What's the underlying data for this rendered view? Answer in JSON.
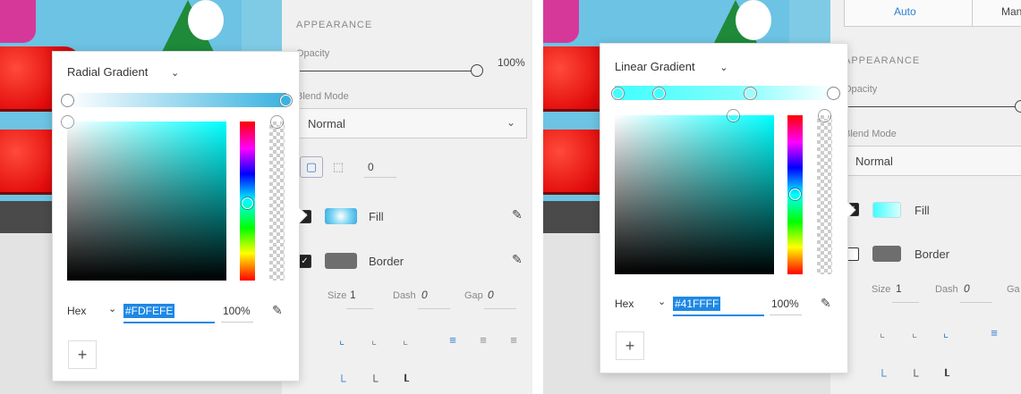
{
  "left": {
    "appearance_title": "APPEARANCE",
    "opacity_label": "Opacity",
    "opacity_value": "100%",
    "opacity_level": 1.0,
    "blend_label": "Blend Mode",
    "blend_value": "Normal",
    "corner_value": "0",
    "fill_label": "Fill",
    "border_label": "Border",
    "size_label": "Size",
    "size_value": "1",
    "dash_label": "Dash",
    "dash_value": "0",
    "gap_label": "Gap",
    "gap_value": "0",
    "picker": {
      "gradient_type": "Radial Gradient",
      "hex_label": "Hex",
      "hex_value": "#FDFEFE",
      "alpha_value": "100%",
      "add_label": "+"
    }
  },
  "right": {
    "segment": {
      "auto": "Auto",
      "manual": "Man"
    },
    "appearance_title": "APPEARANCE",
    "opacity_label": "Opacity",
    "blend_label": "Blend Mode",
    "blend_value": "Normal",
    "fill_label": "Fill",
    "border_label": "Border",
    "size_label": "Size",
    "size_value": "1",
    "dash_label": "Dash",
    "dash_value": "0",
    "gap_label": "Ga",
    "picker": {
      "gradient_type": "Linear Gradient",
      "hex_label": "Hex",
      "hex_value": "#41FFFF",
      "alpha_value": "100%",
      "add_label": "+"
    }
  },
  "colors": {
    "accent": "#1e88e5",
    "cyan": "#41ffff",
    "fill_radial": "#3aa9dc",
    "border_gray": "#6e6e6e",
    "canvas_bg": "#7fcbe6",
    "button_red": "#e10b0b"
  }
}
